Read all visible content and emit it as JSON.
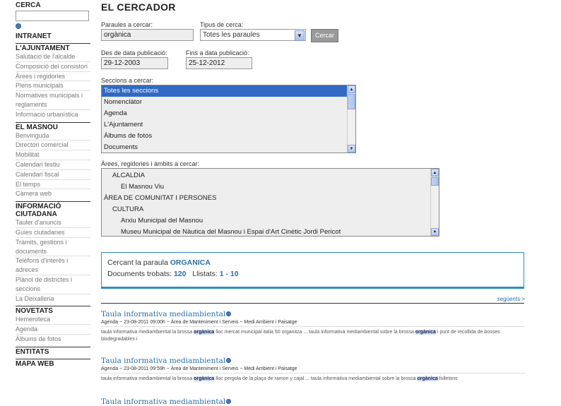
{
  "sidebar": {
    "search_heading": "CERCA",
    "sections": [
      {
        "heading": "INTRANET",
        "items": []
      },
      {
        "heading": "L'AJUNTAMENT",
        "items": [
          "Salutació de l'alcalde",
          "Composició del consistori",
          "Àrees i regidories",
          "Plens municipals",
          "Normatives municipals i reglaments",
          "Informació urbanística"
        ]
      },
      {
        "heading": "EL MASNOU",
        "items": [
          "Benvinguda",
          "Directori comercial",
          "Mobilitat",
          "Calendari festiu",
          "Calendari fiscal",
          "El temps",
          "Càmera web"
        ]
      },
      {
        "heading": "INFORMACIÓ CIUTADANA",
        "items": [
          "Tauler d'anuncis",
          "Guies ciutadanes",
          "Tràmits, gestions i documents",
          "Telèfons d'interès i adreces",
          "Plànol de districtes i seccions",
          "La Deixalleria"
        ]
      },
      {
        "heading": "NOVETATS",
        "items": [
          "Hemeroteca",
          "Agenda",
          "Àlbums de fotos"
        ]
      },
      {
        "heading": "ENTITATS",
        "items": []
      },
      {
        "heading": "MAPA WEB",
        "items": []
      }
    ]
  },
  "main": {
    "title": "EL CERCADOR",
    "words_label": "Paraules a cercar:",
    "words_value": "orgànica",
    "type_label": "Tipus de cerca:",
    "type_value": "Totes les paraules",
    "search_button": "Cercar",
    "from_label": "Des de data publicació:",
    "from_value": "29-12-2003",
    "to_label": "Fins a data publicació:",
    "to_value": "25-12-2012",
    "sections_label": "Seccions a cercar:",
    "sections_options": [
      "Totes les seccions",
      "Nomenclàtor",
      "Agenda",
      "L'Ajuntament",
      "Àlbums de fotos",
      "Documents"
    ],
    "areas_label": "Àrees, regidories i àmbits a cercar:",
    "areas_options": [
      {
        "text": "ALCALDIA",
        "indent": 1
      },
      {
        "text": "El Masnou Viu",
        "indent": 2
      },
      {
        "text": "ÀREA DE COMUNITAT I PERSONES",
        "indent": 0
      },
      {
        "text": "CULTURA",
        "indent": 1
      },
      {
        "text": "Arxiu Municipal del Masnou",
        "indent": 2
      },
      {
        "text": "Museu Municipal de Nàutica del Masnou i Espai d'Art Cinètic Jordi Pericot",
        "indent": 2
      }
    ],
    "result_summary": {
      "searching_prefix": "Cercant la paraula",
      "word": "ORGANICA",
      "found_label": "Documents trobats:",
      "found_count": "120",
      "listed_label": "Llistats:",
      "listed_range": "1 - 10"
    },
    "next_link": "següents >",
    "results": [
      {
        "title": "Taula informativa mediambiental",
        "meta": "Agenda ~ 23-08-2011 09:00h ~ Àrea de Manteniment i Serveis ~ Medi Ambient i Paisatge",
        "snippet_parts": [
          "taula informativa mediambiental la brossa ",
          "orgànica",
          " lloc mercat municipal italia 50 organitza ... taula informativa mediambiental sobre la brossa ",
          "orgànica",
          " i punt de recollida de bosses biodegradables i"
        ]
      },
      {
        "title": "Taula informativa mediambiental",
        "meta": "Agenda ~ 23-08-2011 09:59h ~ Àrea de Manteniment i Serveis ~ Medi Ambient i Paisatge",
        "snippet_parts": [
          "taula informativa mediambiental la brossa ",
          "orgànica",
          " lloc pergola de la plaça de ramon y cajal ... taula informativa mediambiental sobre la brossa ",
          "orgànica",
          " fulletons"
        ]
      },
      {
        "title": "Taula informativa mediambiental",
        "meta": "",
        "snippet_parts": []
      }
    ]
  }
}
